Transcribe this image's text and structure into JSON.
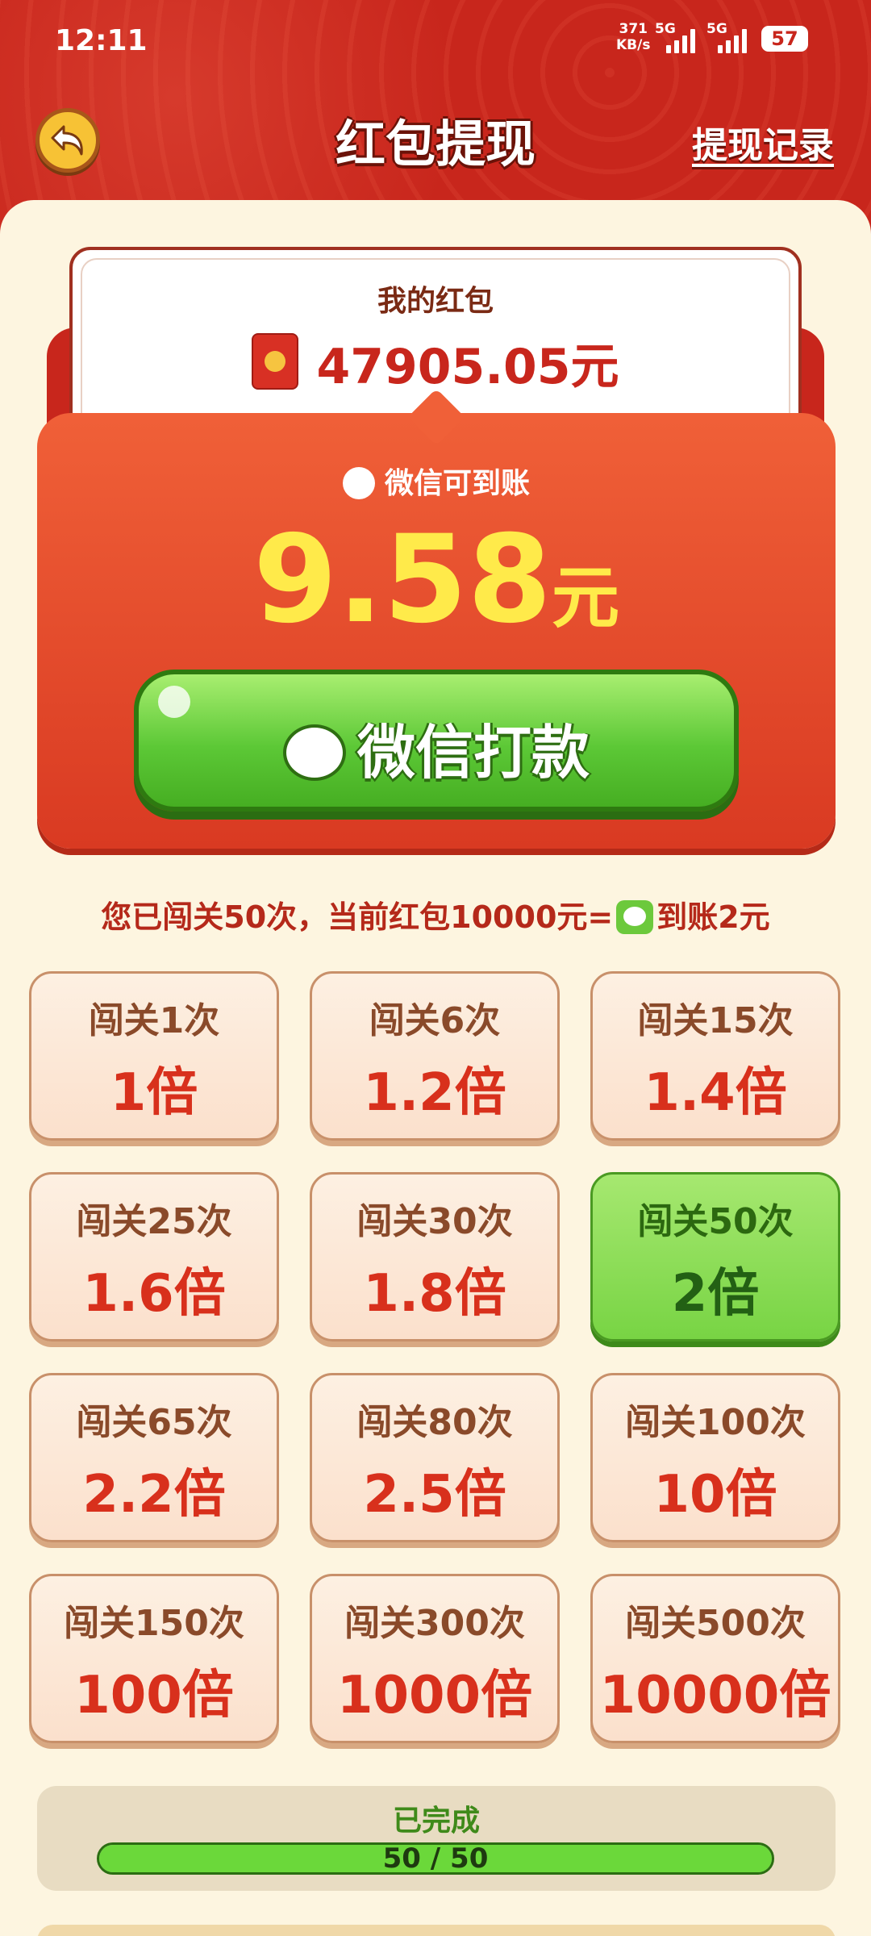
{
  "status_bar": {
    "time": "12:11",
    "net_speed": "371",
    "net_unit": "KB/s",
    "net1": "5G",
    "net2": "5G",
    "battery": "57"
  },
  "header": {
    "title": "红包提现",
    "record_link": "提现记录"
  },
  "wallet": {
    "label": "我的红包",
    "amount": "47905.05元"
  },
  "withdraw": {
    "subtitle": "微信可到账",
    "amount": "9.58",
    "unit": "元",
    "button": "微信打款"
  },
  "info": {
    "prefix": "您已闯关50次，当前红包10000元=",
    "suffix": "到账2元"
  },
  "tiers": [
    {
      "label": "闯关1次",
      "multiplier": "1倍",
      "active": false
    },
    {
      "label": "闯关6次",
      "multiplier": "1.2倍",
      "active": false
    },
    {
      "label": "闯关15次",
      "multiplier": "1.4倍",
      "active": false
    },
    {
      "label": "闯关25次",
      "multiplier": "1.6倍",
      "active": false
    },
    {
      "label": "闯关30次",
      "multiplier": "1.8倍",
      "active": false
    },
    {
      "label": "闯关50次",
      "multiplier": "2倍",
      "active": true
    },
    {
      "label": "闯关65次",
      "multiplier": "2.2倍",
      "active": false
    },
    {
      "label": "闯关80次",
      "multiplier": "2.5倍",
      "active": false
    },
    {
      "label": "闯关100次",
      "multiplier": "10倍",
      "active": false
    },
    {
      "label": "闯关150次",
      "multiplier": "100倍",
      "active": false
    },
    {
      "label": "闯关300次",
      "multiplier": "1000倍",
      "active": false
    },
    {
      "label": "闯关500次",
      "multiplier": "10000倍",
      "active": false
    }
  ],
  "progress": {
    "label": "已完成",
    "text": "50 / 50",
    "fraction": 1.0
  },
  "colors": {
    "brand_red": "#c8261c",
    "accent_yellow": "#ffea4a",
    "wechat_green": "#5cc836"
  }
}
